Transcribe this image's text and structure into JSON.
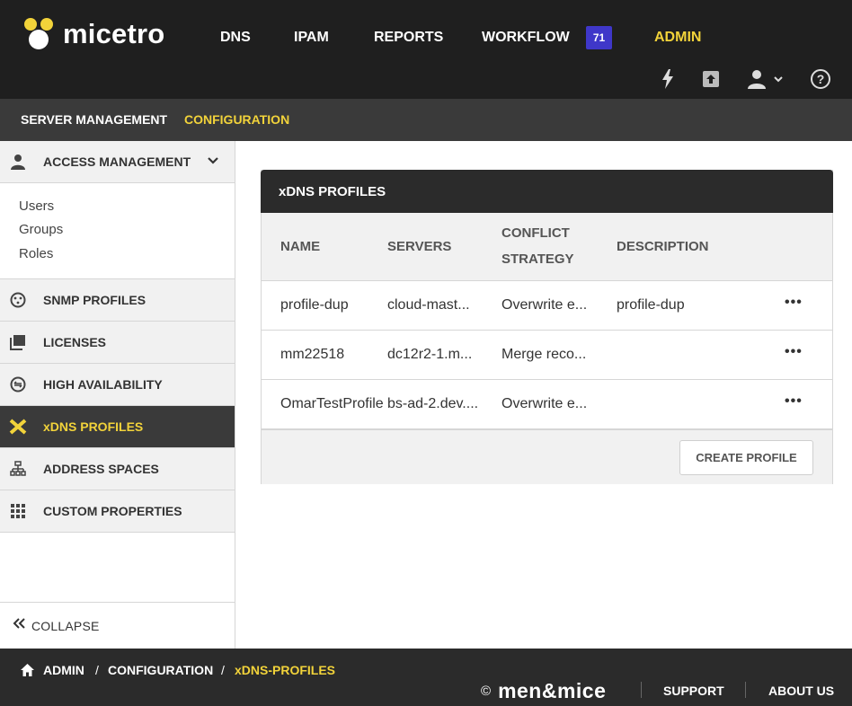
{
  "app": {
    "logo_text": "micetro"
  },
  "nav": {
    "items": [
      {
        "label": "DNS"
      },
      {
        "label": "IPAM"
      },
      {
        "label": "REPORTS"
      },
      {
        "label": "WORKFLOW"
      },
      {
        "label": "ADMIN"
      }
    ],
    "workflow_badge": "71",
    "active": "ADMIN"
  },
  "top_icons": [
    "lightning-icon",
    "upload-box-icon",
    "user-icon",
    "help-icon"
  ],
  "subnav": {
    "items": [
      {
        "label": "SERVER MANAGEMENT"
      },
      {
        "label": "CONFIGURATION"
      }
    ],
    "active": "CONFIGURATION"
  },
  "sidebar": {
    "access_management": {
      "label": "ACCESS MANAGEMENT",
      "sub_items": [
        "Users",
        "Groups",
        "Roles"
      ]
    },
    "sections": [
      {
        "label": "SNMP PROFILES",
        "icon": "snmp-icon"
      },
      {
        "label": "LICENSES",
        "icon": "licenses-icon"
      },
      {
        "label": "HIGH AVAILABILITY",
        "icon": "high-availability-icon"
      },
      {
        "label": "xDNS PROFILES",
        "icon": "xdns-icon",
        "active": true
      },
      {
        "label": "ADDRESS SPACES",
        "icon": "address-spaces-icon"
      },
      {
        "label": "CUSTOM PROPERTIES",
        "icon": "custom-properties-icon"
      }
    ],
    "collapse_label": "COLLAPSE"
  },
  "panel": {
    "title": "xDNS PROFILES",
    "columns": [
      "NAME",
      "SERVERS",
      "CONFLICT",
      "STRATEGY",
      "DESCRIPTION"
    ],
    "rows": [
      {
        "name": "profile-dup",
        "servers": "cloud-mast...",
        "strategy": "Overwrite e...",
        "description": "profile-dup"
      },
      {
        "name": "mm22518",
        "servers": "dc12r2-1.m...",
        "strategy": "Merge reco...",
        "description": ""
      },
      {
        "name": "OmarTestProfile",
        "servers": "bs-ad-2.dev....",
        "strategy": "Overwrite e...",
        "description": ""
      }
    ],
    "row_menu": "•••",
    "create_button": "CREATE PROFILE"
  },
  "footer": {
    "breadcrumb": [
      "ADMIN",
      "CONFIGURATION",
      "xDNS-PROFILES"
    ],
    "breadcrumb_sep": "/",
    "copyright": "©",
    "brand": "men&mice",
    "links": [
      "SUPPORT",
      "ABOUT US"
    ]
  },
  "colors": {
    "topbar": "#1f1f1f",
    "accent": "#f2d33a",
    "badge": "#3f37c9",
    "subnav": "#3a3a3a"
  }
}
